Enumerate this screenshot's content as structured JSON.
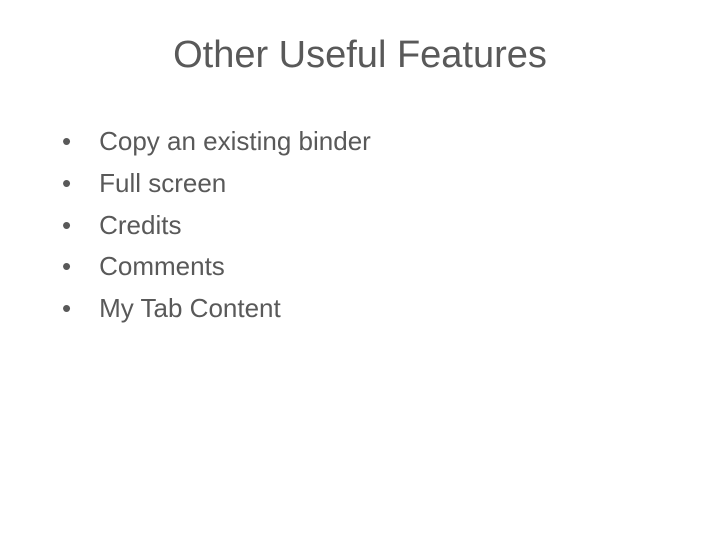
{
  "slide": {
    "title": "Other Useful Features",
    "bullets": [
      "Copy an existing binder",
      "Full screen",
      "Credits",
      "Comments",
      "My Tab Content"
    ]
  }
}
